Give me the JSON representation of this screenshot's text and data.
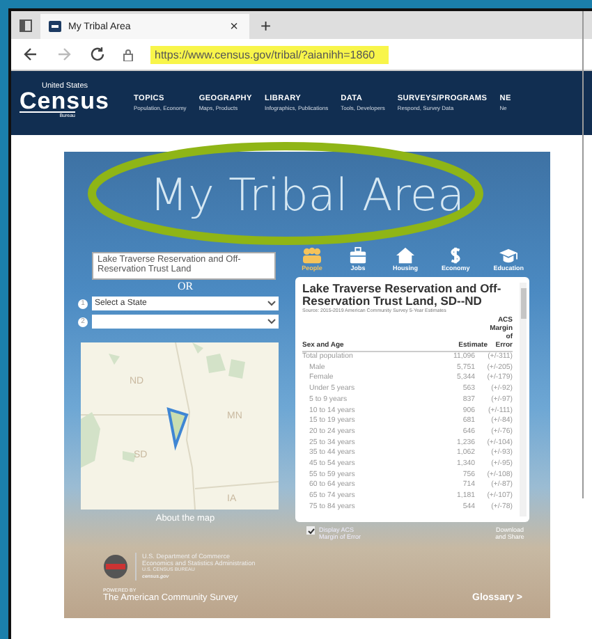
{
  "browser": {
    "tab": {
      "title": "My Tribal Area",
      "close": "×"
    },
    "new_tab": "+",
    "url": "https://www.census.gov/tribal/?aianihh=1860"
  },
  "header": {
    "logo": {
      "top": "United States",
      "name": "Census",
      "bottom": "Bureau"
    },
    "nav": [
      {
        "title": "TOPICS",
        "sub": "Population, Economy"
      },
      {
        "title": "GEOGRAPHY",
        "sub": "Maps, Products"
      },
      {
        "title": "LIBRARY",
        "sub": "Infographics, Publications"
      },
      {
        "title": "DATA",
        "sub": "Tools, Developers"
      },
      {
        "title": "SURVEYS/PROGRAMS",
        "sub": "Respond, Survey Data"
      },
      {
        "title": "NE",
        "sub": "Ne"
      }
    ]
  },
  "page": {
    "title": "My Tribal Area",
    "search": {
      "value": "Lake Traverse Reservation and Off-Reservation Trust Land"
    },
    "or": "OR",
    "selects": [
      {
        "step": "1",
        "value": "Select a State"
      },
      {
        "step": "2"
      }
    ],
    "map": {
      "labels": [
        "ND",
        "MN",
        "SD",
        "IA"
      ],
      "link": "About the map"
    },
    "topics": [
      {
        "label": "People",
        "kind": "people",
        "selected": true
      },
      {
        "label": "Jobs",
        "kind": "jobs",
        "selected": false
      },
      {
        "label": "Housing",
        "kind": "housing",
        "selected": false
      },
      {
        "label": "Economy",
        "kind": "economy",
        "selected": false
      },
      {
        "label": "Education",
        "kind": "education",
        "selected": false
      }
    ],
    "table": {
      "title": "Lake Traverse Reservation and Off-Reservation Trust Land, SD--ND",
      "source": "Source: 2015-2019 American Community Survey 5-Year Estimates",
      "columns": [
        "Sex and Age",
        "Estimate",
        "ACS Margin of Error"
      ],
      "rows": [
        {
          "label": "Total population",
          "kind": "total",
          "estimate": "11,096",
          "moe": "(+/-311)"
        },
        {
          "label": "Male",
          "kind": "item",
          "estimate": "5,751",
          "moe": "(+/-205)"
        },
        {
          "label": "Female",
          "kind": "item",
          "estimate": "5,344",
          "moe": "(+/-179)"
        },
        {
          "label": "Under 5 years",
          "kind": "item",
          "estimate": "563",
          "moe": "(+/-92)"
        },
        {
          "label": "5 to 9 years",
          "kind": "item",
          "estimate": "837",
          "moe": "(+/-97)"
        },
        {
          "label": "10 to 14 years",
          "kind": "item",
          "estimate": "906",
          "moe": "(+/-111)"
        },
        {
          "label": "15 to 19 years",
          "kind": "item",
          "estimate": "681",
          "moe": "(+/-84)"
        },
        {
          "label": "20 to 24 years",
          "kind": "item",
          "estimate": "646",
          "moe": "(+/-76)"
        },
        {
          "label": "25 to 34 years",
          "kind": "item",
          "estimate": "1,236",
          "moe": "(+/-104)"
        },
        {
          "label": "35 to 44 years",
          "kind": "item",
          "estimate": "1,062",
          "moe": "(+/-93)"
        },
        {
          "label": "45 to 54 years",
          "kind": "item",
          "estimate": "1,340",
          "moe": "(+/-95)"
        },
        {
          "label": "55 to 59 years",
          "kind": "item",
          "estimate": "756",
          "moe": "(+/-108)"
        },
        {
          "label": "60 to 64 years",
          "kind": "item",
          "estimate": "714",
          "moe": "(+/-87)"
        },
        {
          "label": "65 to 74 years",
          "kind": "item",
          "estimate": "1,181",
          "moe": "(+/-107)"
        },
        {
          "label": "75 to 84 years",
          "kind": "item",
          "estimate": "544",
          "moe": "(+/-78)"
        }
      ]
    },
    "margin_toggle": {
      "label": "Display ACS Margin of Error",
      "checked": true
    },
    "download": "Download and Share",
    "footer": {
      "agency": [
        "U.S. Department of Commerce",
        "Economics and Statistics Administration",
        "U.S. CENSUS BUREAU",
        "census.gov"
      ],
      "powered_by": "POWERED BY",
      "survey": "The American Community Survey",
      "glossary": "Glossary >"
    }
  }
}
